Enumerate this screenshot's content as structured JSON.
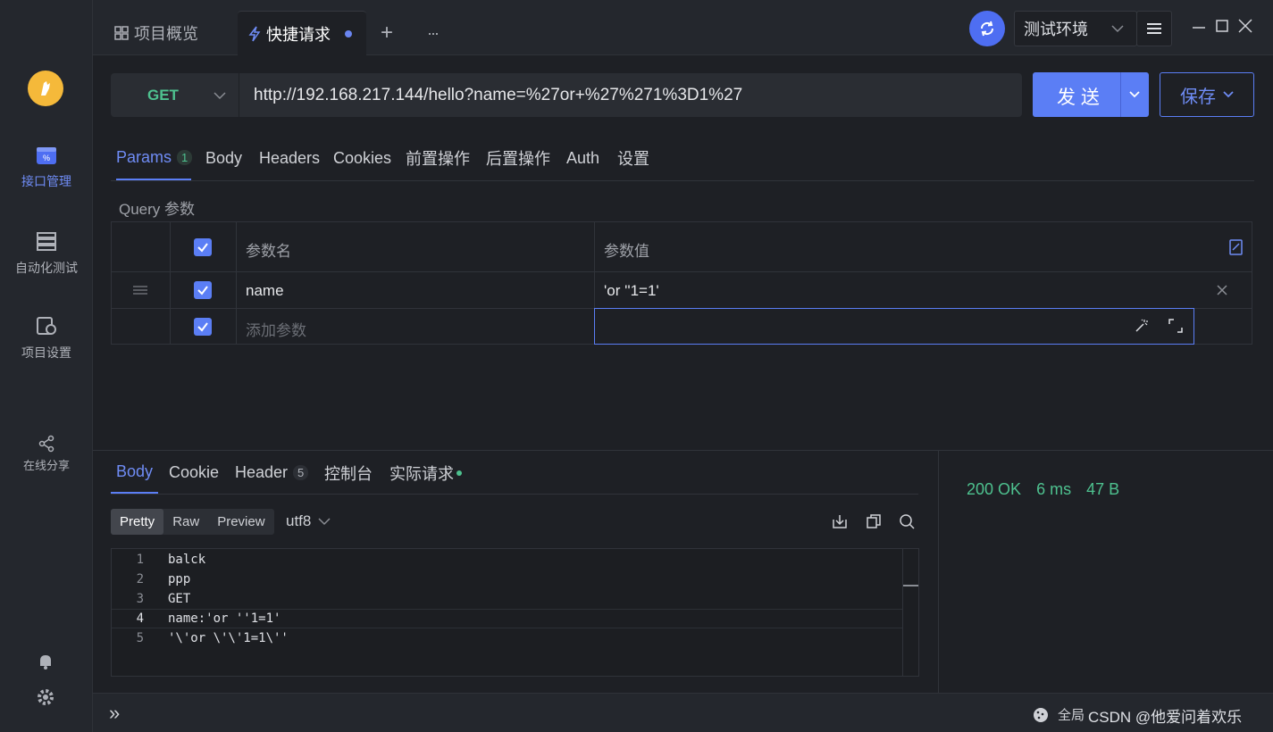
{
  "sidebar": {
    "items": [
      {
        "label": "接口管理",
        "icon": "api-management-icon"
      },
      {
        "label": "自动化测试",
        "icon": "automation-test-icon"
      },
      {
        "label": "项目设置",
        "icon": "project-settings-icon"
      },
      {
        "label": "在线分享",
        "icon": "share-icon"
      }
    ]
  },
  "topbar": {
    "tabs": [
      {
        "label": "项目概览",
        "icon": "grid-icon"
      },
      {
        "label": "快捷请求",
        "icon": "lightning-icon"
      }
    ],
    "add_tab": "+",
    "more": "···",
    "environment": "测试环境"
  },
  "request": {
    "method": "GET",
    "url": "http://192.168.217.144/hello?name=%27or+%27%271%3D1%27",
    "send_label": "发 送",
    "save_label": "保存"
  },
  "request_tabs": [
    {
      "label": "Params",
      "count": "1"
    },
    {
      "label": "Body"
    },
    {
      "label": "Headers"
    },
    {
      "label": "Cookies"
    },
    {
      "label": "前置操作"
    },
    {
      "label": "后置操作"
    },
    {
      "label": "Auth"
    },
    {
      "label": "设置"
    }
  ],
  "params": {
    "section_label": "Query 参数",
    "header_name": "参数名",
    "header_value": "参数值",
    "rows": [
      {
        "name": "name",
        "value": "'or ''1=1'"
      }
    ],
    "add_placeholder": "添加参数"
  },
  "response": {
    "tabs": [
      {
        "label": "Body"
      },
      {
        "label": "Cookie"
      },
      {
        "label": "Header",
        "count": "5"
      },
      {
        "label": "控制台"
      },
      {
        "label": "实际请求"
      }
    ],
    "view_modes": [
      "Pretty",
      "Raw",
      "Preview"
    ],
    "encoding": "utf8",
    "lines": [
      {
        "n": "1",
        "text": "balck"
      },
      {
        "n": "2",
        "text": "ppp"
      },
      {
        "n": "3",
        "text": "GET"
      },
      {
        "n": "4",
        "text": "name:'or ''1=1'"
      },
      {
        "n": "5",
        "text": "'\\'or \\'\\'1=1\\''"
      }
    ],
    "status": "200 OK",
    "time": "6 ms",
    "size": "47 B"
  },
  "bottombar": {
    "expand": "»",
    "global_label": "全局",
    "watermark": "CSDN @他爱问着欢乐"
  },
  "colors": {
    "accent": "#5b7ef5",
    "success": "#4ec18f",
    "background": "#1e2025"
  }
}
